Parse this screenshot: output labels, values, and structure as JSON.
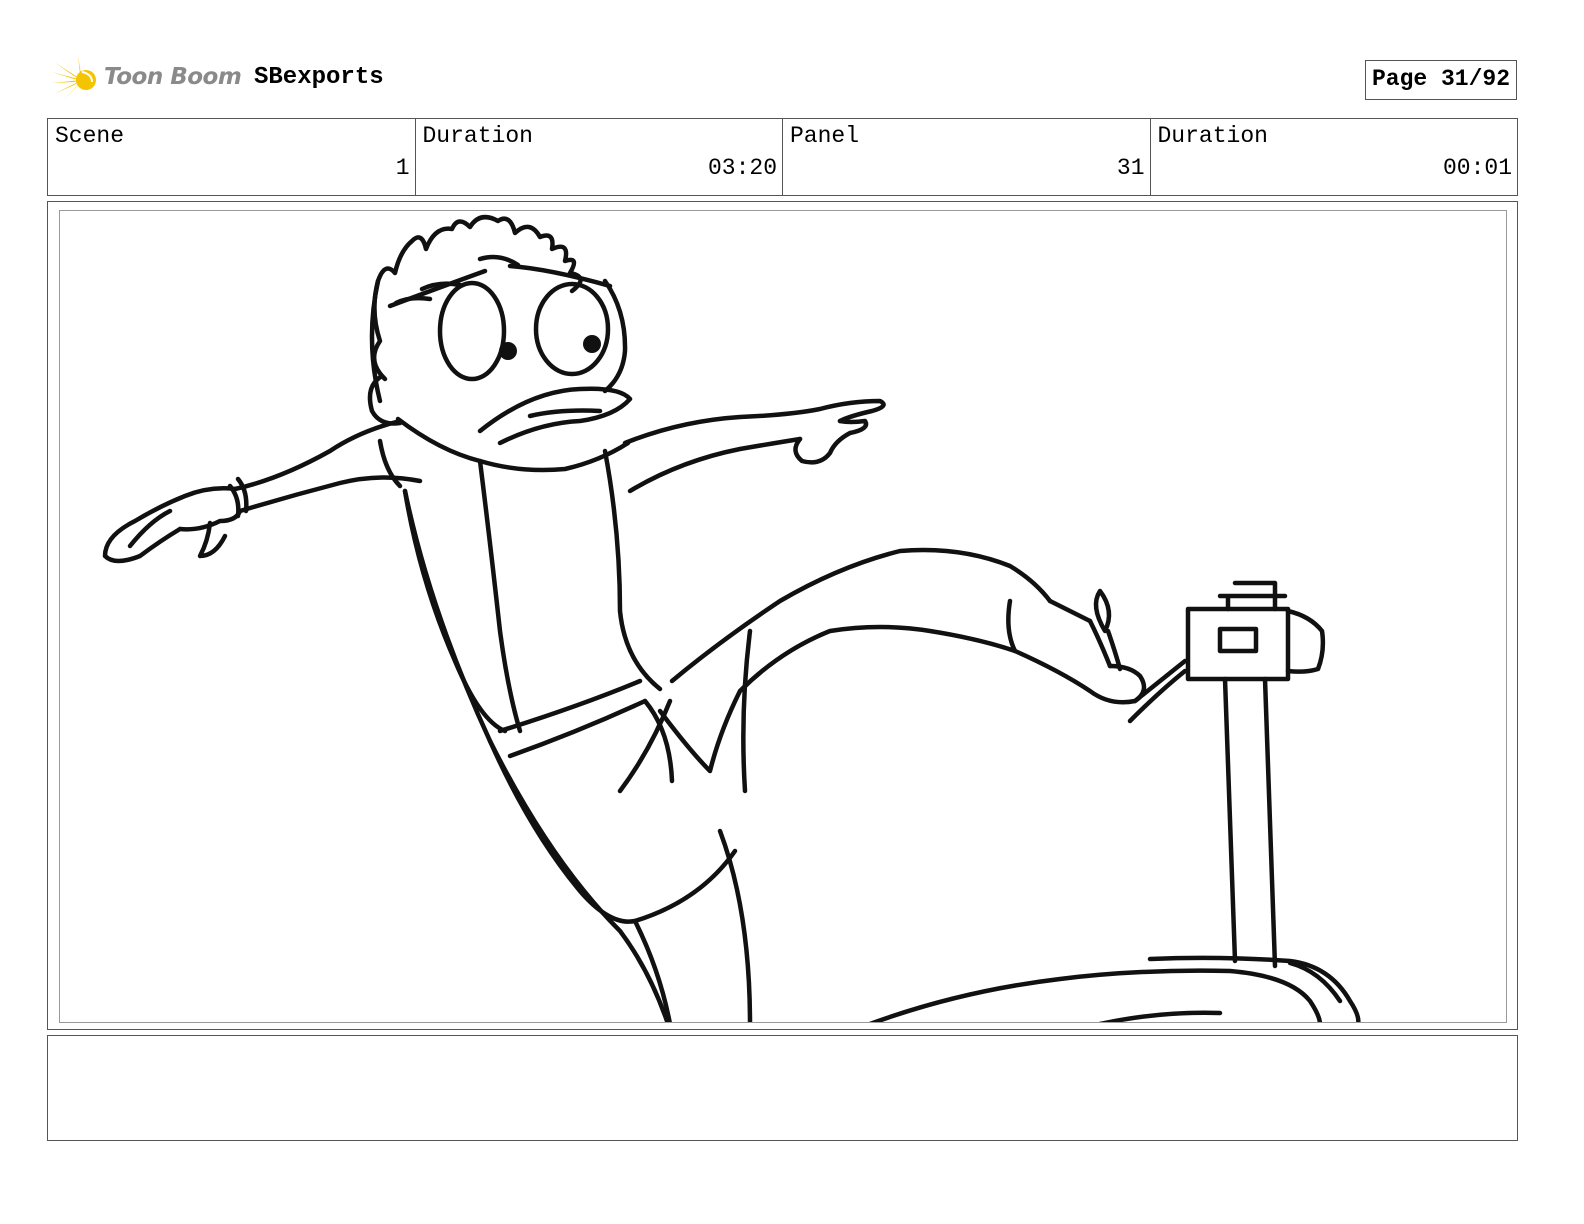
{
  "header": {
    "brand_name": "Toon Boom",
    "project_name": "SBexports",
    "page_label": "Page 31/92"
  },
  "info": [
    {
      "label": "Scene",
      "value": "1"
    },
    {
      "label": "Duration",
      "value": "03:20"
    },
    {
      "label": "Panel",
      "value": "31"
    },
    {
      "label": "Duration",
      "value": "00:01"
    }
  ],
  "panel": {
    "image": "storyboard-sketch"
  },
  "notes": {
    "text": ""
  },
  "colors": {
    "logo_accent": "#f5c400",
    "logo_text": "#8a8a8a",
    "border": "#555555"
  }
}
